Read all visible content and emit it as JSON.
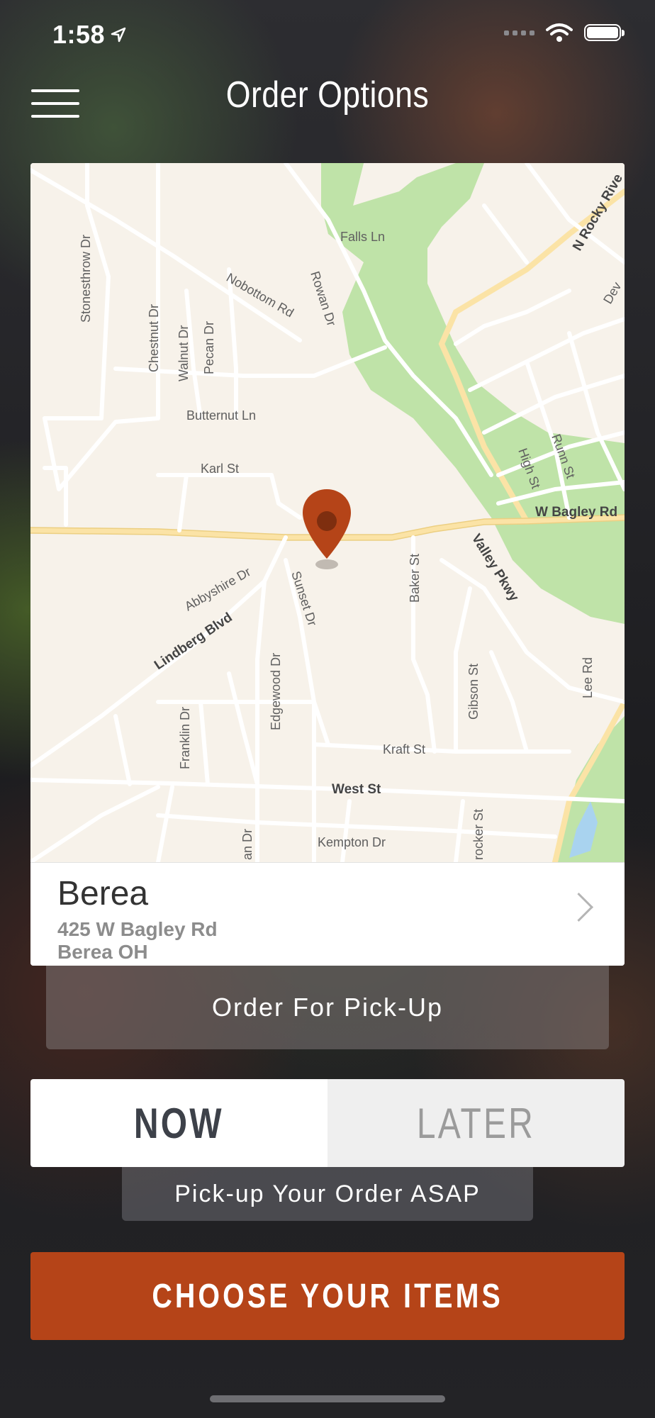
{
  "status_bar": {
    "time": "1:58"
  },
  "header": {
    "title": "Order Options"
  },
  "map": {
    "streets": [
      "Falls Ln",
      "Nobottom Rd",
      "Rowan Dr",
      "Stonesthrow Dr",
      "Chestnut Dr",
      "Walnut Dr",
      "Pecan Dr",
      "Butternut Ln",
      "Karl St",
      "N Rocky Rive",
      "Dev",
      "High St",
      "Runn St",
      "W Bagley Rd",
      "Valley Pkwy",
      "Abbyshire Dr",
      "Sunset Dr",
      "Baker St",
      "Lindberg Blvd",
      "Franklin Dr",
      "Edgewood Dr",
      "Gibson St",
      "Lee Rd",
      "Kraft St",
      "West St",
      "Kempton Dr",
      "an Dr",
      "rocker St"
    ]
  },
  "location": {
    "name": "Berea",
    "address": "425 W Bagley Rd",
    "city": "Berea OH"
  },
  "order_type": {
    "label": "Order For Pick-Up"
  },
  "timing": {
    "now_label": "NOW",
    "later_label": "LATER",
    "selected": "NOW",
    "description": "Pick-up Your Order ASAP"
  },
  "cta": {
    "label": "CHOOSE YOUR ITEMS"
  },
  "colors": {
    "accent": "#b54418",
    "park": "#bfe3a8",
    "map_bg": "#f7f2ea",
    "major_road": "#fbe3a6"
  }
}
